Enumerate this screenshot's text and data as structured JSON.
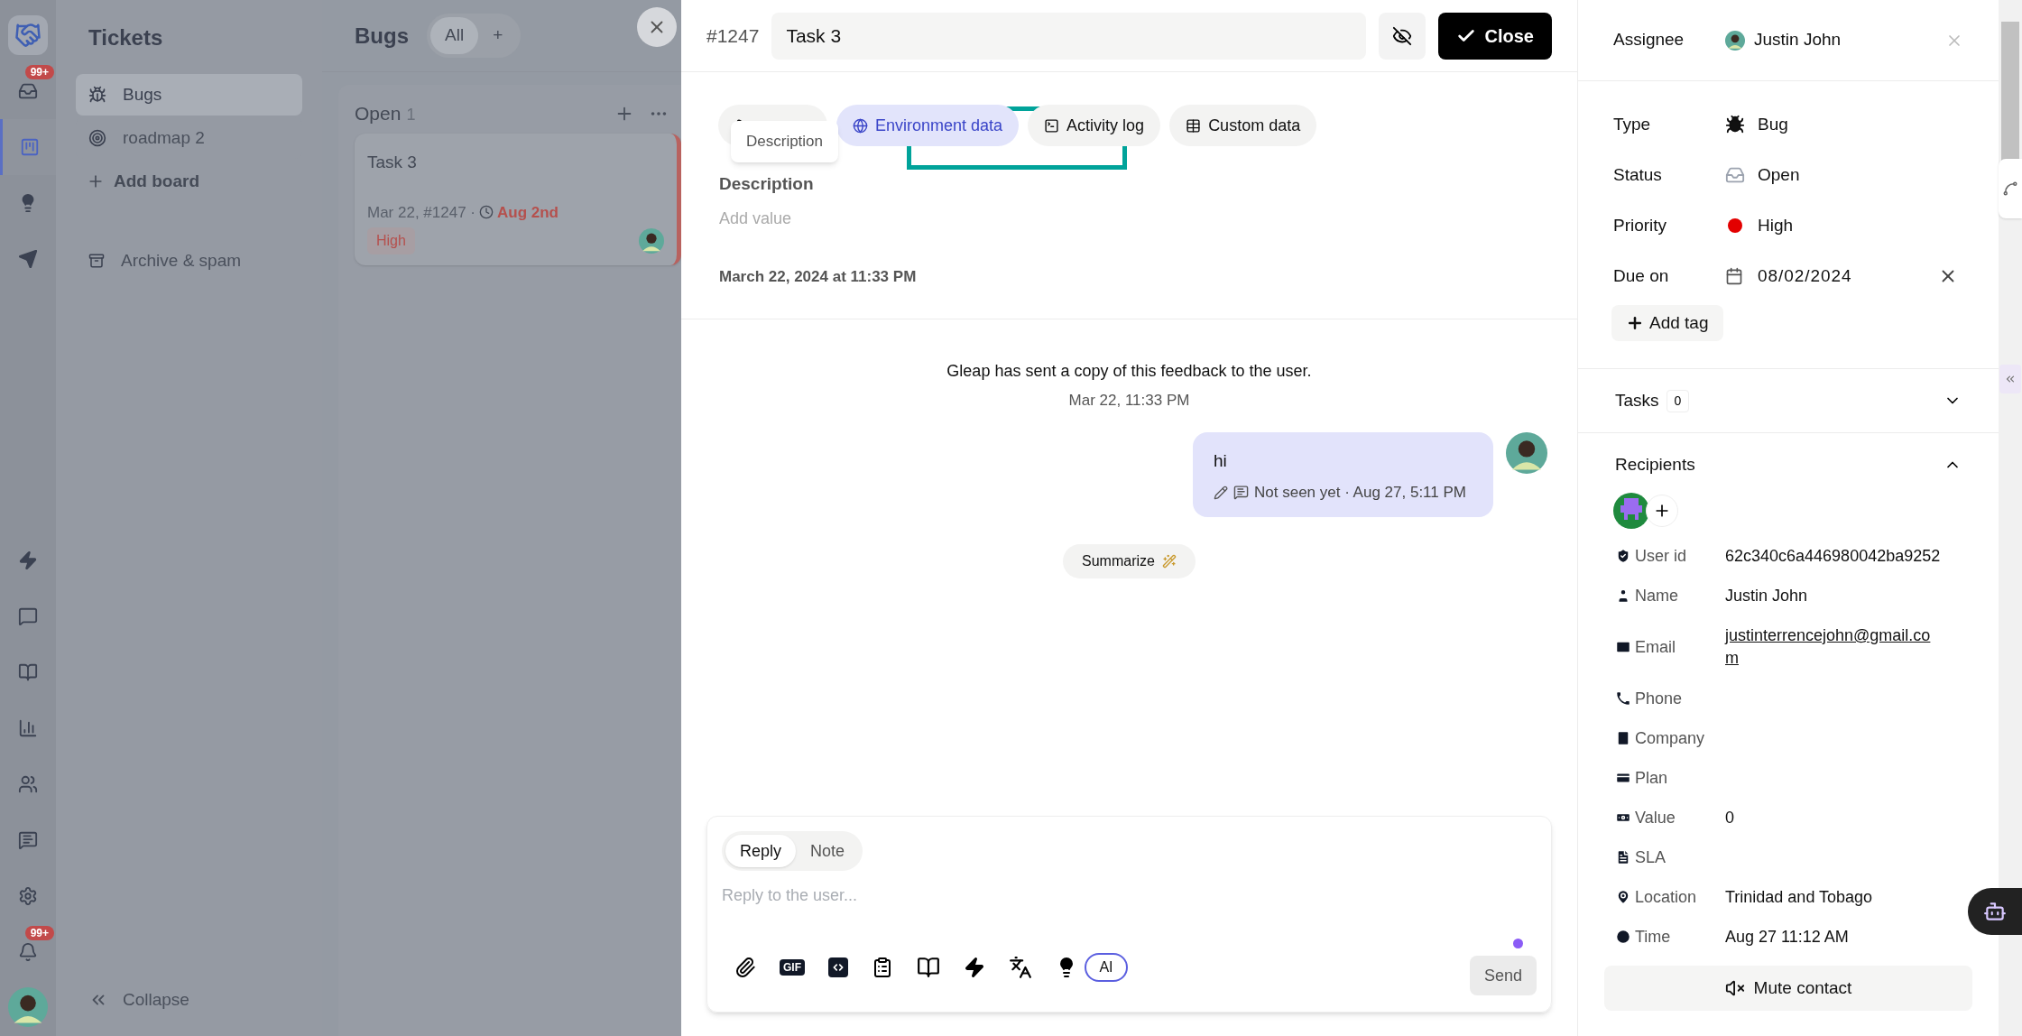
{
  "rail": {
    "top": [
      {
        "kind": "logo",
        "selected": false
      },
      {
        "kind": "inbox",
        "badge": "99+",
        "selected": false
      },
      {
        "kind": "board",
        "selected": true
      },
      {
        "kind": "bulb",
        "selected": false
      },
      {
        "kind": "send",
        "selected": false
      }
    ],
    "bottom": [
      {
        "kind": "bolt",
        "selected": false
      },
      {
        "kind": "chat",
        "selected": false
      },
      {
        "kind": "book",
        "selected": false
      },
      {
        "kind": "chart",
        "selected": false
      },
      {
        "kind": "users",
        "selected": false
      },
      {
        "kind": "chat_text",
        "selected": false
      },
      {
        "kind": "gear",
        "selected": false
      },
      {
        "kind": "bell",
        "badge": "99+",
        "selected": false
      }
    ]
  },
  "sidebar": {
    "title": "Tickets",
    "items": [
      {
        "kind": "bug",
        "label": "Bugs",
        "selected": true
      },
      {
        "kind": "target",
        "label": "roadmap 2",
        "selected": false
      }
    ],
    "add_label": "Add board",
    "archive_label": "Archive & spam",
    "collapse_label": "Collapse"
  },
  "board": {
    "title": "Bugs",
    "filters": [
      {
        "label": "All",
        "selected": true
      },
      {
        "label": "+",
        "selected": false
      }
    ],
    "column": {
      "title": "Open",
      "count": "1",
      "cards": [
        {
          "title": "Task 3",
          "meta": "Mar 22, #1247 ·",
          "due": "Aug 2nd",
          "priority": "High"
        }
      ]
    }
  },
  "ticket": {
    "number": "#1247",
    "title": "Task 3",
    "close_label": "Close",
    "tabs": [
      {
        "kind": "description",
        "selected": false
      },
      {
        "kind": "globe",
        "label": "Environment data",
        "selected": true
      },
      {
        "kind": "terminal",
        "label": "Activity log",
        "selected": false
      },
      {
        "kind": "table",
        "label": "Custom data",
        "selected": false
      }
    ],
    "tooltip": "Description",
    "description_label": "Description",
    "description_placeholder": "Add value",
    "created": "March 22, 2024 at 11:33 PM"
  },
  "conversation": {
    "system_message": "Gleap has sent a copy of this feedback to the user.",
    "system_time": "Mar 22, 11:33 PM",
    "messages": [
      {
        "text": "hi",
        "status": "Not seen yet · Aug 27, 5:11 PM"
      }
    ],
    "summarize_label": "Summarize"
  },
  "composer": {
    "modes": [
      {
        "label": "Reply",
        "selected": true
      },
      {
        "label": "Note",
        "selected": false
      }
    ],
    "placeholder": "Reply to the user...",
    "gif_label": "GIF",
    "ai_label": "AI",
    "send_label": "Send"
  },
  "details": {
    "assignee": {
      "label": "Assignee",
      "value": "Justin John"
    },
    "fields": [
      {
        "kind": "type",
        "label": "Type",
        "value": "Bug"
      },
      {
        "kind": "status",
        "label": "Status",
        "value": "Open"
      },
      {
        "kind": "priority",
        "label": "Priority",
        "value": "High",
        "color": "#e30000"
      },
      {
        "kind": "due",
        "label": "Due on",
        "value": "08/02/2024"
      }
    ],
    "add_tag_label": "Add tag",
    "tasks": {
      "label": "Tasks",
      "count": "0",
      "expanded": false
    },
    "recipients": {
      "label": "Recipients",
      "expanded": true
    },
    "contact": [
      {
        "kind": "user_id",
        "label": "User id",
        "value": "62c340c6a446980042ba9252"
      },
      {
        "kind": "name",
        "label": "Name",
        "value": "Justin John"
      },
      {
        "kind": "email",
        "label": "Email",
        "value": "justinterrencejohn@gmail.com"
      },
      {
        "kind": "phone",
        "label": "Phone"
      },
      {
        "kind": "company",
        "label": "Company"
      },
      {
        "kind": "plan",
        "label": "Plan"
      },
      {
        "kind": "value",
        "label": "Value",
        "value": "0"
      },
      {
        "kind": "sla",
        "label": "SLA"
      },
      {
        "kind": "location",
        "label": "Location",
        "value": "Trinidad and Tobago"
      },
      {
        "kind": "time",
        "label": "Time",
        "value": "Aug 27 11:12 AM"
      }
    ],
    "mute_label": "Mute contact"
  }
}
